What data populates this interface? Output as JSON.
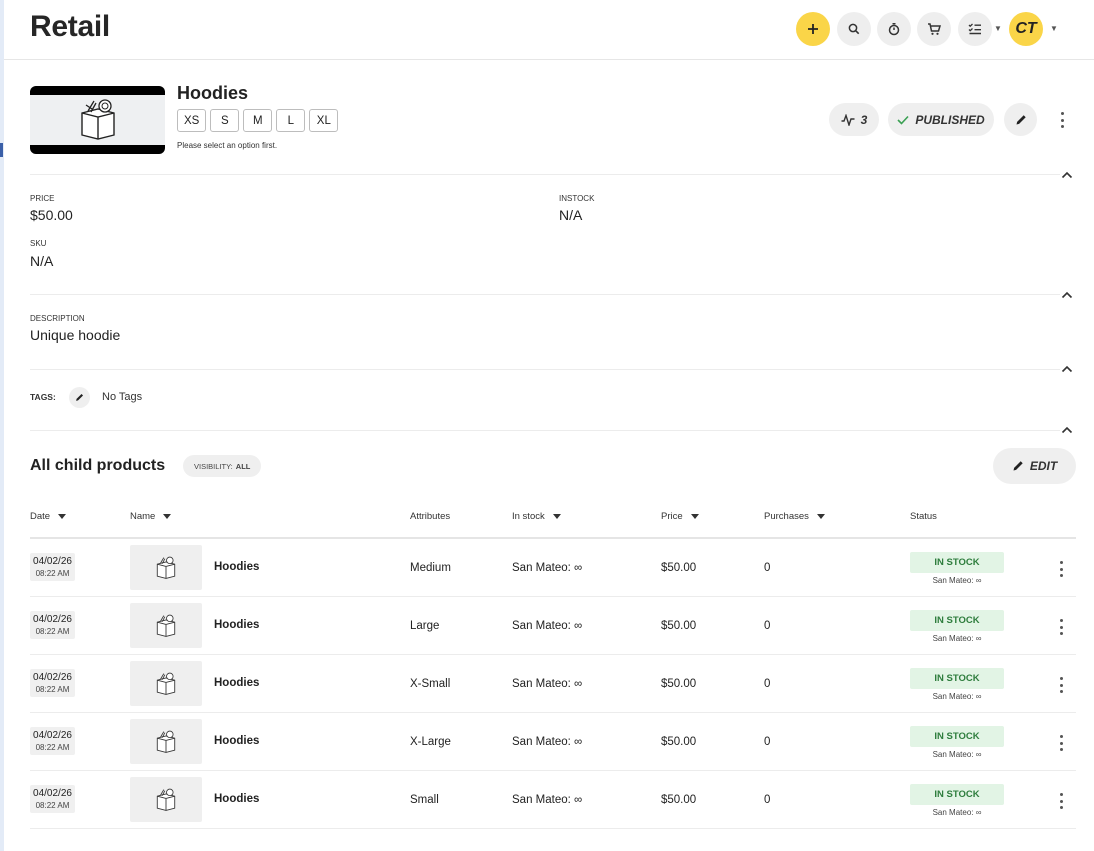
{
  "app": {
    "title": "Retail"
  },
  "toolbar": {
    "add_icon": "plus-icon",
    "search_icon": "search-icon",
    "timer_icon": "timer-icon",
    "cart_icon": "cart-icon",
    "tasks_icon": "checklist-icon",
    "avatar_initials": "CT",
    "accent_color": "#fad548"
  },
  "product": {
    "title": "Hoodies",
    "sizes": [
      "XS",
      "S",
      "M",
      "L",
      "XL"
    ],
    "hint": "Please select an option first.",
    "activity_count": "3",
    "status_label": "PUBLISHED",
    "price_label": "PRICE",
    "price_value": "$50.00",
    "instock_label": "INSTOCK",
    "instock_value": "N/A",
    "sku_label": "SKU",
    "sku_value": "N/A",
    "description_label": "DESCRIPTION",
    "description_value": "Unique hoodie",
    "tags_label": "TAGS:",
    "tags_value": "No Tags"
  },
  "children": {
    "title": "All child products",
    "visibility_label": "VISIBILITY:",
    "visibility_value": "ALL",
    "edit_label": "EDIT",
    "columns": {
      "date": "Date",
      "name": "Name",
      "attributes": "Attributes",
      "in_stock": "In stock",
      "price": "Price",
      "purchases": "Purchases",
      "status": "Status"
    },
    "rows": [
      {
        "date": "04/02/26",
        "time": "08:22 AM",
        "name": "Hoodies",
        "attribute": "Medium",
        "stock": "San Mateo: ∞",
        "price": "$50.00",
        "purchases": "0",
        "status": "IN STOCK",
        "status_sub": "San Mateo: ∞"
      },
      {
        "date": "04/02/26",
        "time": "08:22 AM",
        "name": "Hoodies",
        "attribute": "Large",
        "stock": "San Mateo: ∞",
        "price": "$50.00",
        "purchases": "0",
        "status": "IN STOCK",
        "status_sub": "San Mateo: ∞"
      },
      {
        "date": "04/02/26",
        "time": "08:22 AM",
        "name": "Hoodies",
        "attribute": "X-Small",
        "stock": "San Mateo: ∞",
        "price": "$50.00",
        "purchases": "0",
        "status": "IN STOCK",
        "status_sub": "San Mateo: ∞"
      },
      {
        "date": "04/02/26",
        "time": "08:22 AM",
        "name": "Hoodies",
        "attribute": "X-Large",
        "stock": "San Mateo: ∞",
        "price": "$50.00",
        "purchases": "0",
        "status": "IN STOCK",
        "status_sub": "San Mateo: ∞"
      },
      {
        "date": "04/02/26",
        "time": "08:22 AM",
        "name": "Hoodies",
        "attribute": "Small",
        "stock": "San Mateo: ∞",
        "price": "$50.00",
        "purchases": "0",
        "status": "IN STOCK",
        "status_sub": "San Mateo: ∞"
      }
    ]
  }
}
